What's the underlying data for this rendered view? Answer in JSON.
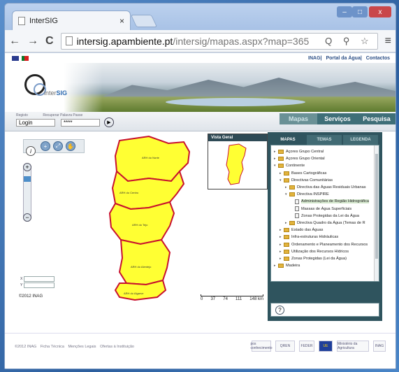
{
  "browser": {
    "tab_title": "InterSIG",
    "tab_close": "×",
    "window_min": "‒",
    "window_max": "□",
    "window_close": "x",
    "nav_back": "←",
    "nav_forward": "→",
    "nav_reload": "C",
    "url_host": "intersig.apambiente.pt",
    "url_path": "/intersig/mapas.aspx?map=365",
    "omni_icons": "Q ⚲ ☆",
    "menu": "≡"
  },
  "header": {
    "toplinks": [
      "INAG",
      "Portal da Água",
      "Contactos"
    ],
    "logo_prefix": "inter",
    "logo_suffix": "SIG"
  },
  "login": {
    "label_register": "Registo",
    "label_forgot": "Recuperar Palavra Passe",
    "user_value": "Login",
    "pass_value": "****",
    "go": "▶"
  },
  "nav": {
    "tabs": [
      "Mapas",
      "Serviços",
      "Pesquisa"
    ]
  },
  "map": {
    "tools": [
      "+",
      "⤢",
      "✋"
    ],
    "info": "i",
    "zoom_plus": "+",
    "zoom_minus": "−",
    "region_labels": [
      "ARH do Norte",
      "ARH do Centro",
      "ARH do Tejo",
      "ARH do Alentejo",
      "ARH do Algarve"
    ],
    "overview_title": "Vista Geral",
    "coord_x": "X",
    "coord_y": "Y",
    "copyright": "©2012 INAG",
    "scale_labels": [
      "0",
      "37",
      "74",
      "111",
      "148 km"
    ]
  },
  "sidepanel": {
    "tabs": [
      "MAPAS",
      "TEMAS",
      "LEGENDA"
    ],
    "help": "?",
    "tree": [
      {
        "indent": 0,
        "type": "folder",
        "toggle": "▸",
        "label": "Açores Grupo Central"
      },
      {
        "indent": 0,
        "type": "folder",
        "toggle": "▸",
        "label": "Açores Grupo Oriental"
      },
      {
        "indent": 0,
        "type": "folder",
        "toggle": "▾",
        "label": "Continente"
      },
      {
        "indent": 1,
        "type": "folder",
        "toggle": "▸",
        "label": "Bases Cartográficas"
      },
      {
        "indent": 1,
        "type": "folder",
        "toggle": "▾",
        "label": "Directivas Comunitárias"
      },
      {
        "indent": 2,
        "type": "folder",
        "toggle": "▸",
        "label": "Directiva das Águas Residuais Urbanas"
      },
      {
        "indent": 2,
        "type": "folder",
        "toggle": "▾",
        "label": "Directiva INSPIRE"
      },
      {
        "indent": 3,
        "type": "doc",
        "toggle": "",
        "label": "Administrações de Região Hidrográfica"
      },
      {
        "indent": 3,
        "type": "doc",
        "toggle": "",
        "label": "Massas de Água Superficiais"
      },
      {
        "indent": 3,
        "type": "doc",
        "toggle": "",
        "label": "Zonas Protegidas da Lei da Água"
      },
      {
        "indent": 2,
        "type": "folder",
        "toggle": "▸",
        "label": "Directiva Quadro da Água (Temas de R"
      },
      {
        "indent": 1,
        "type": "folder",
        "toggle": "▸",
        "label": "Estado das Águas"
      },
      {
        "indent": 1,
        "type": "folder",
        "toggle": "▸",
        "label": "Infra-estruturas Hidráulicas"
      },
      {
        "indent": 1,
        "type": "folder",
        "toggle": "▸",
        "label": "Ordenamento e Planeamento dos Recursos"
      },
      {
        "indent": 1,
        "type": "folder",
        "toggle": "▸",
        "label": "Utilização dos Recursos Hídricos"
      },
      {
        "indent": 1,
        "type": "folder",
        "toggle": "▸",
        "label": "Zonas Protegidas (Lei da Água)"
      },
      {
        "indent": 0,
        "type": "folder",
        "toggle": "▸",
        "label": "Madeira"
      }
    ]
  },
  "footer": {
    "links": [
      "©2012 INAG",
      "Ficha Técnica",
      "Menções Legais",
      "Ofertas à Instituição"
    ],
    "partners": [
      "pos conhecimento",
      "QREN",
      "FEDER",
      "UE",
      "Ministério da Agricultura",
      "INAG"
    ]
  },
  "colors": {
    "map_fill": "#ffff33",
    "map_border": "#c8102e",
    "panel": "#2f545e"
  }
}
